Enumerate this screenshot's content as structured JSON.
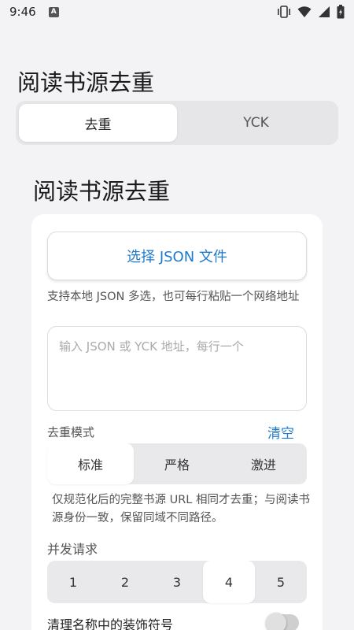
{
  "status_bar": {
    "time": "9:46",
    "notif_icon_letter": "A",
    "icons": [
      "vibrate-icon",
      "wifi-icon",
      "signal-icon",
      "battery-icon"
    ]
  },
  "app": {
    "title": "阅读书源去重"
  },
  "top_tabs": [
    {
      "label": "去重",
      "active": true
    },
    {
      "label": "YCK",
      "active": false
    }
  ],
  "section": {
    "title": "阅读书源去重"
  },
  "form": {
    "file_button_label": "选择 JSON 文件",
    "help_text": "支持本地 JSON 多选，也可每行粘贴一个网络地址",
    "input_placeholder": "输入 JSON 或 YCK 地址，每行一个",
    "input_value": "",
    "mode_label": "去重模式",
    "clear_label": "清空",
    "modes": [
      {
        "label": "标准",
        "active": true
      },
      {
        "label": "严格",
        "active": false
      },
      {
        "label": "激进",
        "active": false
      }
    ],
    "mode_description": "仅规范化后的完整书源 URL 相同才去重；与阅读书源身份一致，保留同域不同路径。",
    "concurrency_label": "并发请求",
    "concurrency_options": [
      {
        "label": "1",
        "active": false
      },
      {
        "label": "2",
        "active": false
      },
      {
        "label": "3",
        "active": false
      },
      {
        "label": "4",
        "active": true
      },
      {
        "label": "5",
        "active": false
      }
    ],
    "clean_symbols_label": "清理名称中的装饰符号",
    "clean_symbols_enabled": false
  },
  "colors": {
    "accent": "#1f7acc",
    "background": "#f3f3f5",
    "card": "#ffffff"
  }
}
